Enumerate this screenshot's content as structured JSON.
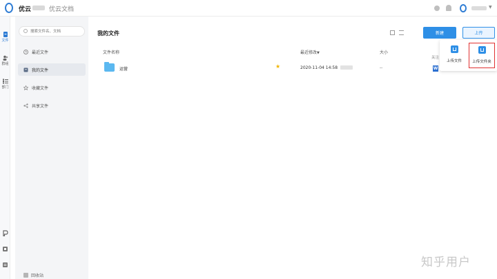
{
  "header": {
    "brand": "优云",
    "product": "优云文档"
  },
  "rail": {
    "items": [
      {
        "label": "文件",
        "icon": "file-icon",
        "active": true
      },
      {
        "label": "群组",
        "icon": "group-icon",
        "active": false
      },
      {
        "label": "部门",
        "icon": "department-icon",
        "active": false
      }
    ]
  },
  "sidebar": {
    "search_placeholder": "搜索文件名、文档",
    "items": [
      {
        "label": "最近文件",
        "icon": "clock-icon"
      },
      {
        "label": "我的文件",
        "icon": "my-files-icon",
        "active": true
      },
      {
        "label": "收藏文件",
        "icon": "star-icon"
      },
      {
        "label": "共享文件",
        "icon": "share-icon"
      }
    ],
    "trash_label": "回收站"
  },
  "main": {
    "title": "我的文件",
    "new_button": "新建",
    "upload_button": "上传",
    "columns": {
      "name": "文件名称",
      "modified": "最近修改",
      "size": "大小"
    },
    "rows": [
      {
        "name": "运营",
        "modified": "2020-11-04 14:58",
        "size": "--",
        "starred": true,
        "type": "folder"
      }
    ],
    "right_column_label": "关注"
  },
  "upload_menu": {
    "items": [
      {
        "label": "上传文件",
        "icon": "upload-file-icon"
      },
      {
        "label": "上传文件夹",
        "icon": "upload-folder-icon",
        "highlighted": true
      }
    ]
  },
  "watermark": "知乎用户",
  "colors": {
    "accent": "#2e8fe6",
    "highlight_border": "#e03030",
    "folder": "#5bb8f0",
    "star": "#f0b400"
  }
}
